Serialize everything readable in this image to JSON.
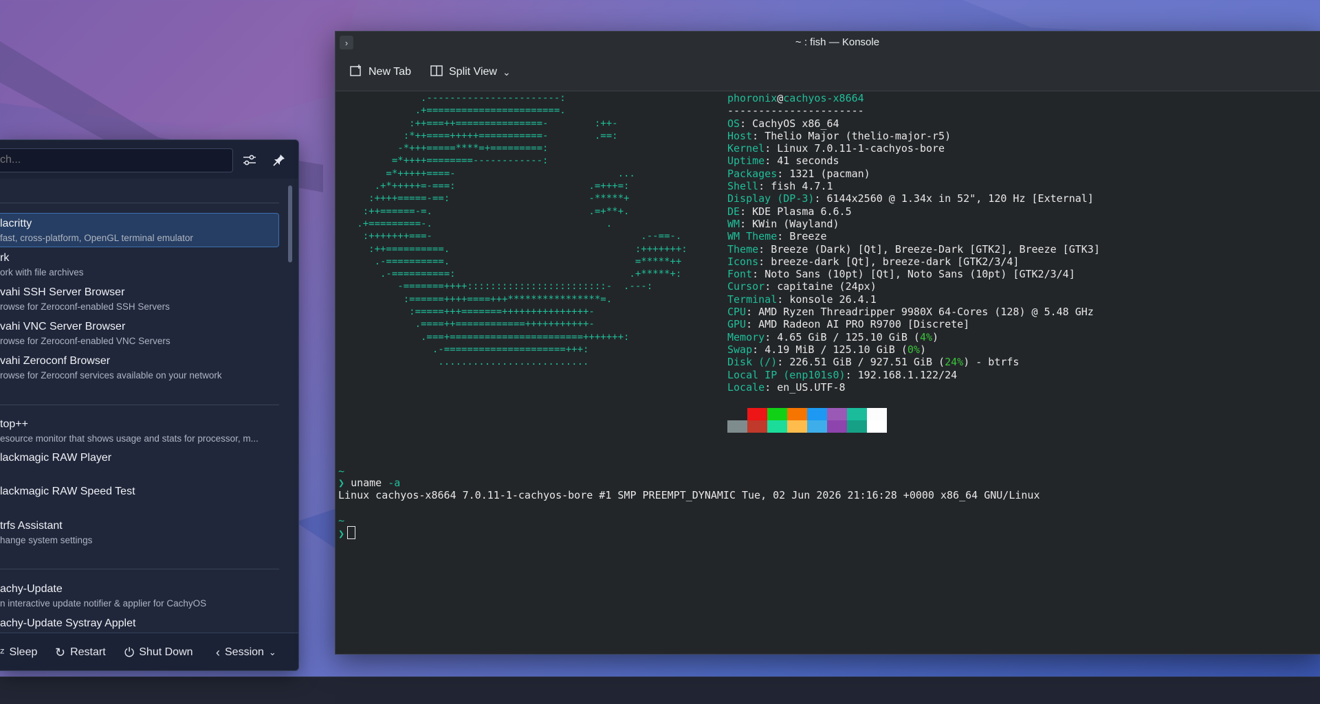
{
  "colors": {
    "accent": "#1fbf9a",
    "percent_green": "#3ac43a",
    "launcher_bg": "#20273b",
    "selected_bg": "#263e63"
  },
  "launcher": {
    "search_placeholder": "ch...",
    "icons": {
      "configure": "sliders-icon",
      "pin": "pin-icon"
    },
    "apps": [
      {
        "title": "lacritty",
        "desc": "fast, cross-platform, OpenGL terminal emulator",
        "selected": true
      },
      {
        "title": "rk",
        "desc": "ork with file archives"
      },
      {
        "title": "vahi SSH Server Browser",
        "desc": "rowse for Zeroconf-enabled SSH Servers"
      },
      {
        "title": "vahi VNC Server Browser",
        "desc": "rowse for Zeroconf-enabled VNC Servers"
      },
      {
        "title": "vahi Zeroconf Browser",
        "desc": "rowse for Zeroconf services available on your network"
      },
      {
        "title": "top++",
        "desc": "esource monitor that shows usage and stats for processor, m..."
      },
      {
        "title": "lackmagic RAW Player",
        "desc": ""
      },
      {
        "title": "lackmagic RAW Speed Test",
        "desc": ""
      },
      {
        "title": "trfs Assistant",
        "desc": "hange system settings"
      },
      {
        "title": "achy-Update",
        "desc": "n interactive update notifier & applier for CachyOS"
      },
      {
        "title": "achy-Update Systray Applet",
        "desc": ""
      }
    ],
    "footer": {
      "sleep": "Sleep",
      "restart": "Restart",
      "shutdown": "Shut Down",
      "session": "Session"
    }
  },
  "konsole": {
    "title": "~ : fish — Konsole",
    "toolbar": {
      "new_tab": "New Tab",
      "split_view": "Split View"
    },
    "ascii_art": "              .-----------------------:\n             .+=======================.\n            :++===++===============-        :++-\n           :*++====+++++===========-        .==:\n          -*+++=====****=+=========:\n         =*++++========------------:\n        =*+++++====-                            ...\n      .+*+++++=-===:                       .=+++=:\n     :++++=====-==:                        -*****+\n    :++======-=.                           .=+**+.\n   .+=========-.                              .\n    :+++++++===-                                    .--==-.\n     :++==========.                                :+++++++:\n      .-==========.                                =*****++\n       .-==========:                              .+*****+:\n          -=======++++::::::::::::::::::::::::-  .---:\n           :======++++====+++****************=.\n            :=====+++=======+++++++++++++++-\n             .====++============+++++++++++-\n              .===+=======================+++++++:\n                .-=====================+++:\n                 ..........................",
    "user": "phoronix",
    "host": "cachyos-x8664",
    "separator": "----------------------",
    "info": [
      {
        "key": "OS",
        "parts": [
          {
            "t": "CachyOS x86_64"
          }
        ]
      },
      {
        "key": "Host",
        "parts": [
          {
            "t": "Thelio Major (thelio-major-r5)"
          }
        ]
      },
      {
        "key": "Kernel",
        "parts": [
          {
            "t": "Linux 7.0.11-1-cachyos-bore"
          }
        ]
      },
      {
        "key": "Uptime",
        "parts": [
          {
            "t": "41 seconds"
          }
        ]
      },
      {
        "key": "Packages",
        "parts": [
          {
            "t": "1321 (pacman)"
          }
        ]
      },
      {
        "key": "Shell",
        "parts": [
          {
            "t": "fish 4.7.1"
          }
        ]
      },
      {
        "key": "Display (DP-3)",
        "parts": [
          {
            "t": "6144x2560 @ 1.34x in 52\", 120 Hz [External]"
          }
        ]
      },
      {
        "key": "DE",
        "parts": [
          {
            "t": "KDE Plasma 6.6.5"
          }
        ]
      },
      {
        "key": "WM",
        "parts": [
          {
            "t": "KWin (Wayland)"
          }
        ]
      },
      {
        "key": "WM Theme",
        "parts": [
          {
            "t": "Breeze"
          }
        ]
      },
      {
        "key": "Theme",
        "parts": [
          {
            "t": "Breeze (Dark) [Qt], Breeze-Dark [GTK2], Breeze [GTK3]"
          }
        ]
      },
      {
        "key": "Icons",
        "parts": [
          {
            "t": "breeze-dark [Qt], breeze-dark [GTK2/3/4]"
          }
        ]
      },
      {
        "key": "Font",
        "parts": [
          {
            "t": "Noto Sans (10pt) [Qt], Noto Sans (10pt) [GTK2/3/4]"
          }
        ]
      },
      {
        "key": "Cursor",
        "parts": [
          {
            "t": "capitaine (24px)"
          }
        ]
      },
      {
        "key": "Terminal",
        "parts": [
          {
            "t": "konsole 26.4.1"
          }
        ]
      },
      {
        "key": "CPU",
        "parts": [
          {
            "t": "AMD Ryzen Threadripper 9980X 64-Cores (128) @ 5.48 GHz"
          }
        ]
      },
      {
        "key": "GPU",
        "parts": [
          {
            "t": "AMD Radeon AI PRO R9700 [Discrete]"
          }
        ]
      },
      {
        "key": "Memory",
        "parts": [
          {
            "t": "4.65 GiB / 125.10 GiB ("
          },
          {
            "t": "4%",
            "pct": true
          },
          {
            "t": ")"
          }
        ]
      },
      {
        "key": "Swap",
        "parts": [
          {
            "t": "4.19 MiB / 125.10 GiB ("
          },
          {
            "t": "0%",
            "pct": true
          },
          {
            "t": ")"
          }
        ]
      },
      {
        "key": "Disk (/)",
        "parts": [
          {
            "t": "226.51 GiB / 927.51 GiB ("
          },
          {
            "t": "24%",
            "pct": true
          },
          {
            "t": ") - btrfs"
          }
        ]
      },
      {
        "key": "Local IP (enp101s0)",
        "parts": [
          {
            "t": "192.168.1.122/24"
          }
        ]
      },
      {
        "key": "Locale",
        "parts": [
          {
            "t": "en_US.UTF-8"
          }
        ]
      }
    ],
    "palette": [
      {
        "top": "#232629",
        "bottom": "#7f8c8d"
      },
      {
        "top": "#ed1515",
        "bottom": "#c0392b"
      },
      {
        "top": "#11d116",
        "bottom": "#1cdc9a"
      },
      {
        "top": "#f67400",
        "bottom": "#fdbc4b"
      },
      {
        "top": "#1d99f3",
        "bottom": "#3daee9"
      },
      {
        "top": "#9b59b6",
        "bottom": "#8e44ad"
      },
      {
        "top": "#1abc9c",
        "bottom": "#16a085"
      },
      {
        "top": "#fcfcfc",
        "bottom": "#ffffff"
      }
    ],
    "session": {
      "tilde": "~",
      "prompt": "❯",
      "command": "uname",
      "arg": "-a",
      "output": "Linux cachyos-x8664 7.0.11-1-cachyos-bore #1 SMP PREEMPT_DYNAMIC Tue, 02 Jun 2026 21:16:28 +0000 x86_64 GNU/Linux"
    }
  }
}
